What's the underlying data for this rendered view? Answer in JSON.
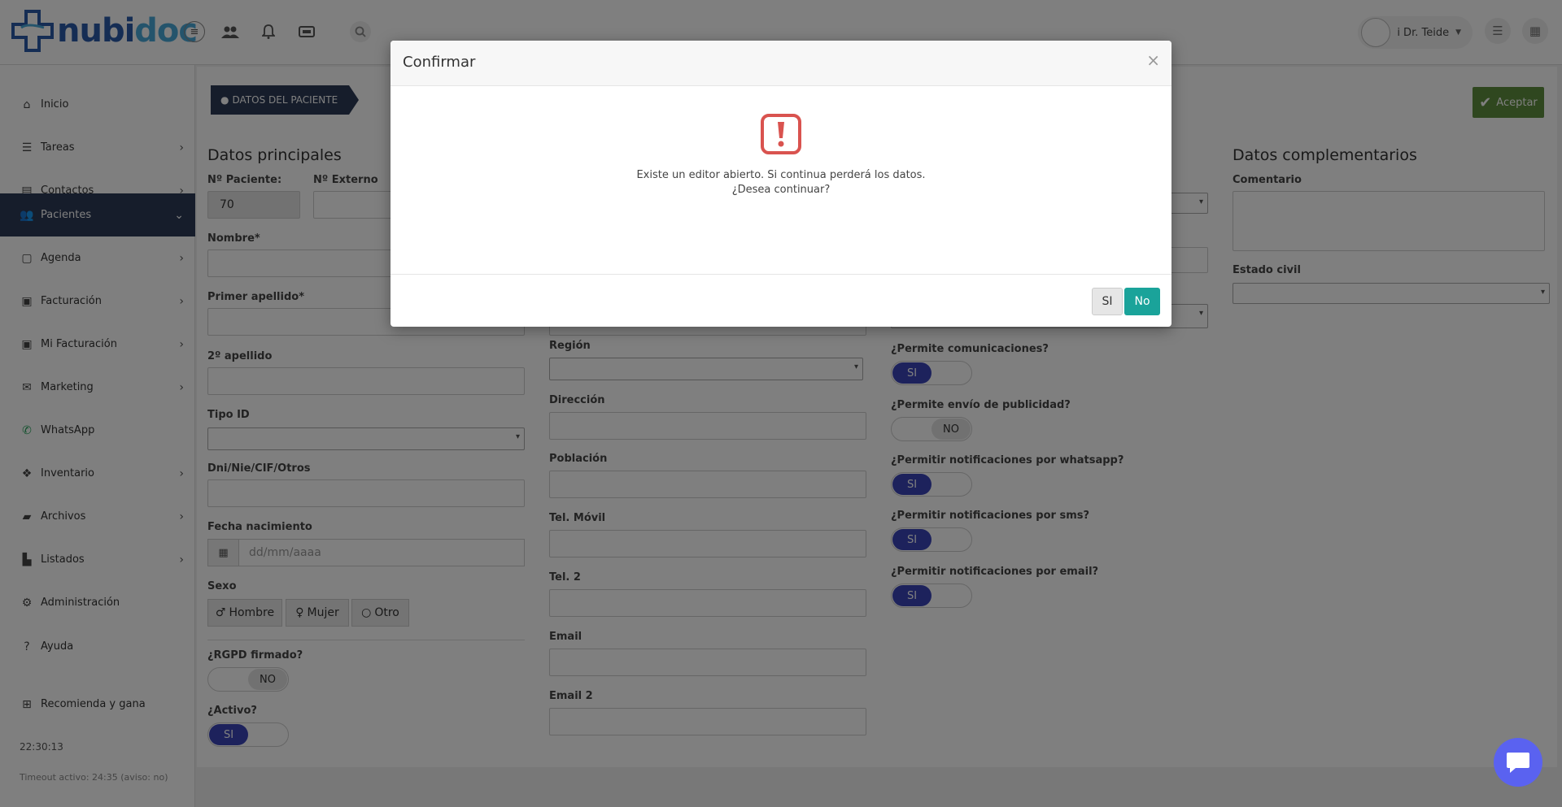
{
  "brand": {
    "logo_part1": "nubi",
    "logo_part2": "doc",
    "accent": "#2a5aa8",
    "accent_light": "#49a8d8"
  },
  "topbar": {
    "user_name": "i Dr. Teide"
  },
  "sidebar": {
    "items": [
      {
        "label": "Inicio",
        "icon": "home-icon"
      },
      {
        "label": "Tareas",
        "icon": "list-icon"
      },
      {
        "label": "Contactos",
        "icon": "address-book-icon"
      },
      {
        "label": "Pacientes",
        "icon": "users-icon"
      },
      {
        "label": "Agenda",
        "icon": "calendar-icon"
      },
      {
        "label": "Facturación",
        "icon": "money-icon"
      },
      {
        "label": "Mi Facturación",
        "icon": "money-icon"
      },
      {
        "label": "Marketing",
        "icon": "envelope-icon"
      },
      {
        "label": "WhatsApp",
        "icon": "whatsapp-icon"
      },
      {
        "label": "Inventario",
        "icon": "cubes-icon"
      },
      {
        "label": "Archivos",
        "icon": "folder-icon"
      },
      {
        "label": "Listados",
        "icon": "chart-icon"
      },
      {
        "label": "Administración",
        "icon": "gear-icon"
      },
      {
        "label": "Ayuda",
        "icon": "question-icon"
      },
      {
        "label": "Recomienda y gana",
        "icon": "gift-icon"
      }
    ],
    "clock": "22:30:13",
    "timeout": "Timeout activo: 24:35 (aviso: no)"
  },
  "main": {
    "breadcrumb": "DATOS DEL PACIENTE",
    "accept_label": "Aceptar",
    "section_main": "Datos principales",
    "section_extra": "Datos complementarios",
    "fields": {
      "num_paciente_label": "Nº Paciente:",
      "num_paciente_value": "70",
      "num_externo_label": "Nº Externo",
      "nombre_label": "Nombre*",
      "apellido1_label": "Primer apellido*",
      "apellido2_label": "2º apellido",
      "tipo_id_label": "Tipo ID",
      "dni_label": "Dni/Nie/CIF/Otros",
      "fecha_label": "Fecha nacimiento",
      "fecha_placeholder": "dd/mm/aaaa",
      "sexo_label": "Sexo",
      "sexo_hombre": "Hombre",
      "sexo_mujer": "Mujer",
      "sexo_otro": "Otro",
      "rgpd_label": "¿RGPD firmado?",
      "rgpd_value": "NO",
      "activo_label": "¿Activo?",
      "activo_value": "SI",
      "region_label": "Región",
      "direccion_label": "Dirección",
      "poblacion_label": "Población",
      "movil_label": "Tel. Móvil",
      "tel2_label": "Tel. 2",
      "email_label": "Email",
      "email2_label": "Email 2",
      "comunicaciones_label": "¿Permite comunicaciones?",
      "comunicaciones_value": "SI",
      "publicidad_label": "¿Permite envío de publicidad?",
      "publicidad_value": "NO",
      "whatsapp_label": "¿Permitir notificaciones por whatsapp?",
      "whatsapp_value": "SI",
      "sms_label": "¿Permitir notificaciones por sms?",
      "sms_value": "SI",
      "email_notif_label": "¿Permitir notificaciones por email?",
      "email_notif_value": "SI",
      "comentario_label": "Comentario",
      "estado_civil_label": "Estado civil"
    }
  },
  "modal": {
    "title": "Confirmar",
    "close": "×",
    "message_line1": "Existe un editor abierto. Si continua perderá los datos.",
    "message_line2": "¿Desea continuar?",
    "yes_label": "SI",
    "no_label": "No",
    "danger_color": "#d9534f",
    "primary_color": "#1aa39a"
  }
}
